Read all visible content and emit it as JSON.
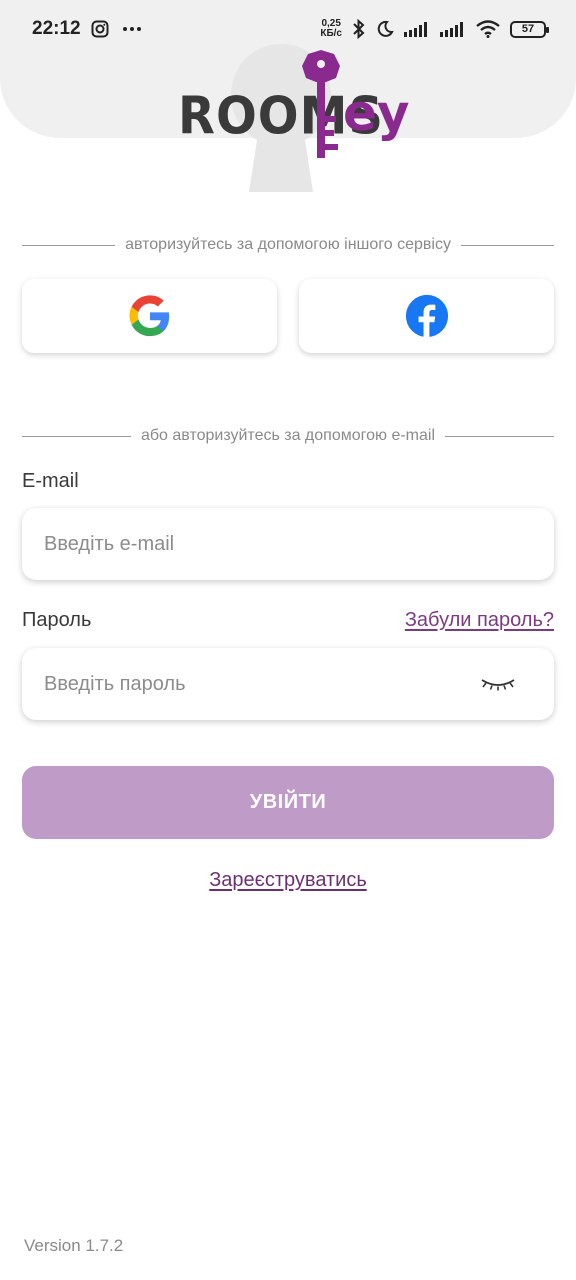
{
  "status_bar": {
    "time": "22:12",
    "speed_value": "0,25",
    "speed_unit": "КБ/с",
    "battery": "57",
    "icons": [
      "instagram-icon",
      "more-icon",
      "bluetooth-icon",
      "moon-icon",
      "signal-icon",
      "signal-icon",
      "wifi-icon",
      "battery-icon"
    ]
  },
  "logo": {
    "text_left": "ROOMS",
    "text_right": "ey",
    "brand_color": "#8a2a8f"
  },
  "social": {
    "divider_text": "авторизуйтесь за допомогою іншого сервісу",
    "buttons": [
      {
        "icon": "google-icon"
      },
      {
        "icon": "facebook-icon"
      }
    ]
  },
  "email_section": {
    "divider_text": "або авторизуйтесь за допомогою e-mail",
    "email_label": "E-mail",
    "email_placeholder": "Введіть e-mail",
    "email_value": "",
    "password_label": "Пароль",
    "forgot_label": "Забули пароль?",
    "password_placeholder": "Введіть пароль",
    "password_value": ""
  },
  "actions": {
    "submit_label": "УВІЙТИ",
    "submit_color": "#bf9bc8",
    "register_label": "Зареєструватись"
  },
  "footer": {
    "version": "Version 1.7.2"
  }
}
